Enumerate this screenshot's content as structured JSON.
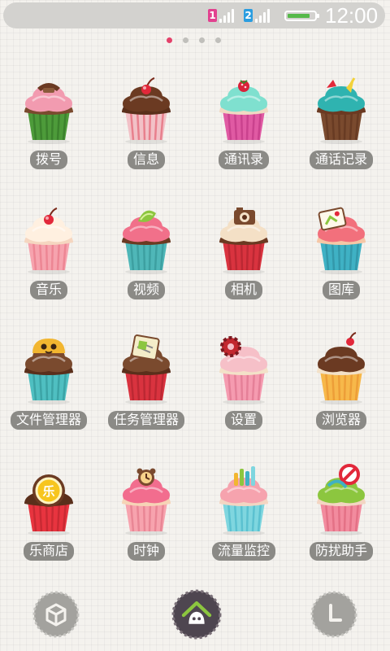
{
  "status_bar": {
    "sim1_label": "1",
    "sim2_label": "2",
    "time": "12:00",
    "sim1_color": "#e2418f",
    "sim2_color": "#2a9de0",
    "battery_color": "#56b94a",
    "battery_level": 0.85
  },
  "pager": {
    "count": 4,
    "active_index": 0,
    "active_color": "#e4416a"
  },
  "apps": [
    {
      "label": "拨号",
      "icon": "cupcake-phone-icon"
    },
    {
      "label": "信息",
      "icon": "cupcake-chocolate-cherry-icon"
    },
    {
      "label": "通讯录",
      "icon": "cupcake-mint-berry-icon"
    },
    {
      "label": "通话记录",
      "icon": "cupcake-teal-arrows-icon"
    },
    {
      "label": "音乐",
      "icon": "cupcake-vanilla-cherry-icon"
    },
    {
      "label": "视频",
      "icon": "cupcake-pink-lime-icon"
    },
    {
      "label": "相机",
      "icon": "cupcake-camera-icon"
    },
    {
      "label": "图库",
      "icon": "cupcake-picture-icon"
    },
    {
      "label": "文件管理器",
      "icon": "cupcake-folder-icon"
    },
    {
      "label": "任务管理器",
      "icon": "cupcake-notes-icon"
    },
    {
      "label": "设置",
      "icon": "cupcake-gear-icon"
    },
    {
      "label": "浏览器",
      "icon": "cupcake-globe-icon"
    },
    {
      "label": "乐商店",
      "icon": "cupcake-store-icon"
    },
    {
      "label": "时钟",
      "icon": "cupcake-clock-icon"
    },
    {
      "label": "流量监控",
      "icon": "cupcake-meter-icon"
    },
    {
      "label": "防扰助手",
      "icon": "cupcake-block-icon"
    }
  ],
  "dock": {
    "left_icon": "cube-icon",
    "center_icon": "home-icon",
    "right_icon": "clock-icon"
  }
}
